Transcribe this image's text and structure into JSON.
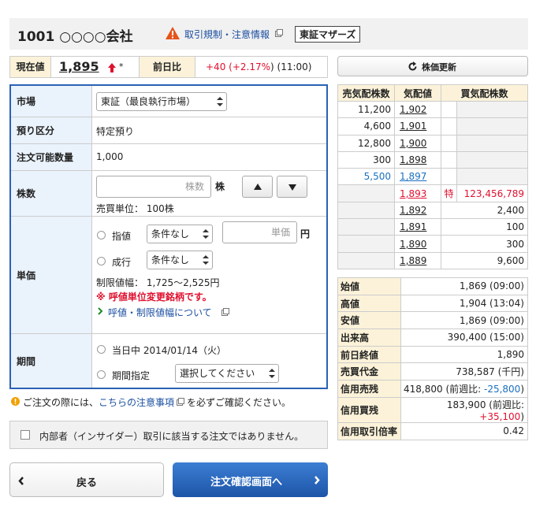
{
  "header": {
    "title": "1001 ○○○○会社",
    "regulation_link": "取引規制・注意情報",
    "market_badge": "東証マザーズ"
  },
  "quote": {
    "current_label": "現在値",
    "current_price": "1,895",
    "star": "*",
    "prev_label": "前日比",
    "change_prefix": "+40 (",
    "change_pct": "+2.17%",
    "change_suffix": ") (11:00)",
    "colors": {
      "up": "#e0102e",
      "accent_blue": "#1a4ea0"
    }
  },
  "form": {
    "market": {
      "label": "市場",
      "value": "東証（最良執行市場）"
    },
    "account": {
      "label": "預り区分",
      "value": "特定預り"
    },
    "available": {
      "label": "注文可能数量",
      "value": "1,000"
    },
    "qty": {
      "label": "株数",
      "placeholder": "株数",
      "unit": "株",
      "trade_unit": "売買単位： 100株"
    },
    "price": {
      "label": "単価",
      "limit_label": "指値",
      "limit_condition": "条件なし",
      "price_placeholder": "単価",
      "unit": "円",
      "market_label": "成行",
      "market_condition": "条件なし",
      "range": "制限値幅： 1,725～2,525円",
      "warning": "※ 呼値単位変更銘柄です。",
      "link": "呼値・制限値幅について"
    },
    "period": {
      "label": "期間",
      "today": "当日中 2014/01/14（火）",
      "specify": "期間指定",
      "select_placeholder": "選択してください"
    }
  },
  "notice": {
    "before": "ご注文の際には、",
    "link": "こちらの注意事項",
    "after": "を必ずご確認ください。"
  },
  "insider": {
    "label": "内部者（インサイダー）取引に該当する注文ではありません。"
  },
  "buttons": {
    "back": "戻る",
    "next": "注文確認画面へ",
    "refresh": "株価更新"
  },
  "board": {
    "headers": [
      "売気配株数",
      "気配値",
      "買気配株数"
    ],
    "sell": [
      {
        "qty": "11,200",
        "price": "1,902"
      },
      {
        "qty": "4,600",
        "price": "1,901"
      },
      {
        "qty": "12,800",
        "price": "1,900"
      },
      {
        "qty": "300",
        "price": "1,898"
      },
      {
        "qty": "5,500",
        "price": "1,897"
      }
    ],
    "special": {
      "price": "1,893",
      "mark": "特",
      "qty": "123,456,789"
    },
    "buy": [
      {
        "price": "1,892",
        "qty": "2,400"
      },
      {
        "price": "1,891",
        "qty": "100"
      },
      {
        "price": "1,890",
        "qty": "300"
      },
      {
        "price": "1,889",
        "qty": "9,600"
      }
    ]
  },
  "stats": [
    {
      "k": "始値",
      "v": "1,869 (09:00)"
    },
    {
      "k": "高値",
      "v": "1,904 (13:04)"
    },
    {
      "k": "安値",
      "v": "1,869 (09:00)"
    },
    {
      "k": "出来高",
      "v": "390,400 (15:00)"
    },
    {
      "k": "前日終値",
      "v": "1,890"
    },
    {
      "k": "売買代金",
      "v": "738,587 (千円)"
    },
    {
      "k": "信用売残",
      "v_main": "418,800 (前週比: ",
      "v_chg": "-25,800",
      "v_end": ")"
    },
    {
      "k": "信用買残",
      "v_main": "183,900 (前週比: ",
      "v_chg": "+35,100",
      "v_end": ")"
    },
    {
      "k": "信用取引倍率",
      "v": "0.42"
    }
  ]
}
